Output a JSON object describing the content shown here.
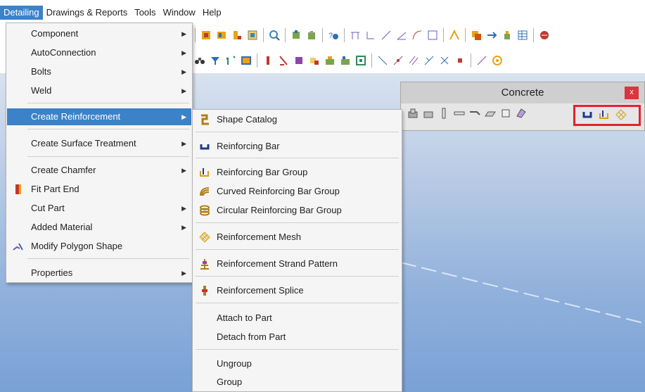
{
  "menubar": {
    "items": [
      "Detailing",
      "Drawings & Reports",
      "Tools",
      "Window",
      "Help"
    ]
  },
  "detailing_menu": {
    "items": [
      {
        "label": "Component",
        "submenu": true
      },
      {
        "label": "AutoConnection",
        "submenu": true
      },
      {
        "label": "Bolts",
        "submenu": true
      },
      {
        "label": "Weld",
        "submenu": true
      },
      {
        "label": "Create Reinforcement",
        "submenu": true,
        "highlighted": true
      },
      {
        "label": "Create Surface Treatment",
        "submenu": true
      },
      {
        "label": "Create Chamfer",
        "submenu": true
      },
      {
        "label": "Fit Part End",
        "submenu": false,
        "icon": "fit-part-end-icon"
      },
      {
        "label": "Cut Part",
        "submenu": true
      },
      {
        "label": "Added Material",
        "submenu": true
      },
      {
        "label": "Modify Polygon Shape",
        "submenu": false,
        "icon": "modify-polygon-icon"
      },
      {
        "label": "Properties",
        "submenu": true
      }
    ]
  },
  "reinforcement_submenu": {
    "items": [
      {
        "label": "Shape Catalog",
        "icon": "shape-catalog-icon"
      },
      {
        "label": "Reinforcing Bar",
        "icon": "reinforcing-bar-icon"
      },
      {
        "label": "Reinforcing Bar Group",
        "icon": "reinforcing-bar-group-icon"
      },
      {
        "label": "Curved Reinforcing Bar Group",
        "icon": "curved-bar-group-icon"
      },
      {
        "label": "Circular Reinforcing Bar Group",
        "icon": "circular-bar-group-icon"
      },
      {
        "label": "Reinforcement Mesh",
        "icon": "reinforcement-mesh-icon"
      },
      {
        "label": "Reinforcement Strand Pattern",
        "icon": "strand-pattern-icon"
      },
      {
        "label": "Reinforcement Splice",
        "icon": "splice-icon"
      },
      {
        "label": "Attach to Part"
      },
      {
        "label": "Detach from Part"
      },
      {
        "label": "Ungroup"
      },
      {
        "label": "Group"
      }
    ]
  },
  "concrete_toolbar": {
    "title": "Concrete",
    "close_label": "x",
    "highlight_color": "#e0242d"
  },
  "colors": {
    "accent": "#3c82c8",
    "red_bar": "#e0242d"
  }
}
